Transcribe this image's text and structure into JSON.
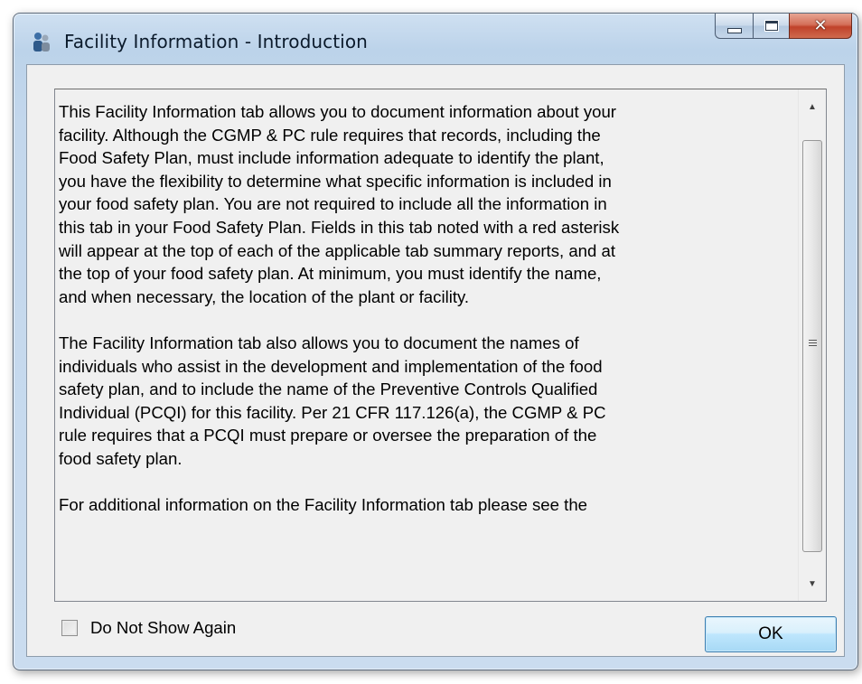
{
  "window": {
    "title": "Facility Information - Introduction",
    "icon": "app-people-icon",
    "caption_buttons": {
      "minimize": "minimize-icon",
      "maximize": "maximize-icon",
      "close": "close-icon"
    }
  },
  "body": {
    "paragraphs": [
      "This Facility Information tab allows you to document information about your\nfacility. Although the CGMP & PC rule requires that records, including the\nFood Safety Plan, must include information adequate to identify the plant,\nyou have the flexibility to determine what specific information is included in\nyour food safety plan. You are not required to include all the information in\nthis tab in your Food Safety Plan. Fields in this tab noted with a red asterisk\nwill appear at the top of each of the applicable tab summary reports, and at\nthe top of your food safety plan. At minimum, you must identify the name,\nand when necessary, the location of the plant or facility.",
      "The Facility Information tab also allows you to document the names of\nindividuals who assist in the development and implementation of the food\nsafety plan, and to include the name of the Preventive Controls Qualified\nIndividual (PCQI) for this facility. Per 21 CFR 117.126(a), the CGMP & PC\nrule requires that a PCQI must prepare or oversee the preparation of the\nfood safety plan.",
      "For additional information on the Facility Information tab please see the"
    ]
  },
  "footer": {
    "checkbox_label": "Do Not Show Again",
    "checkbox_checked": false,
    "ok_label": "OK"
  },
  "colors": {
    "window_frame": "#bcd3ea",
    "close_button": "#c0422a",
    "ok_button": "#bee6fd"
  }
}
